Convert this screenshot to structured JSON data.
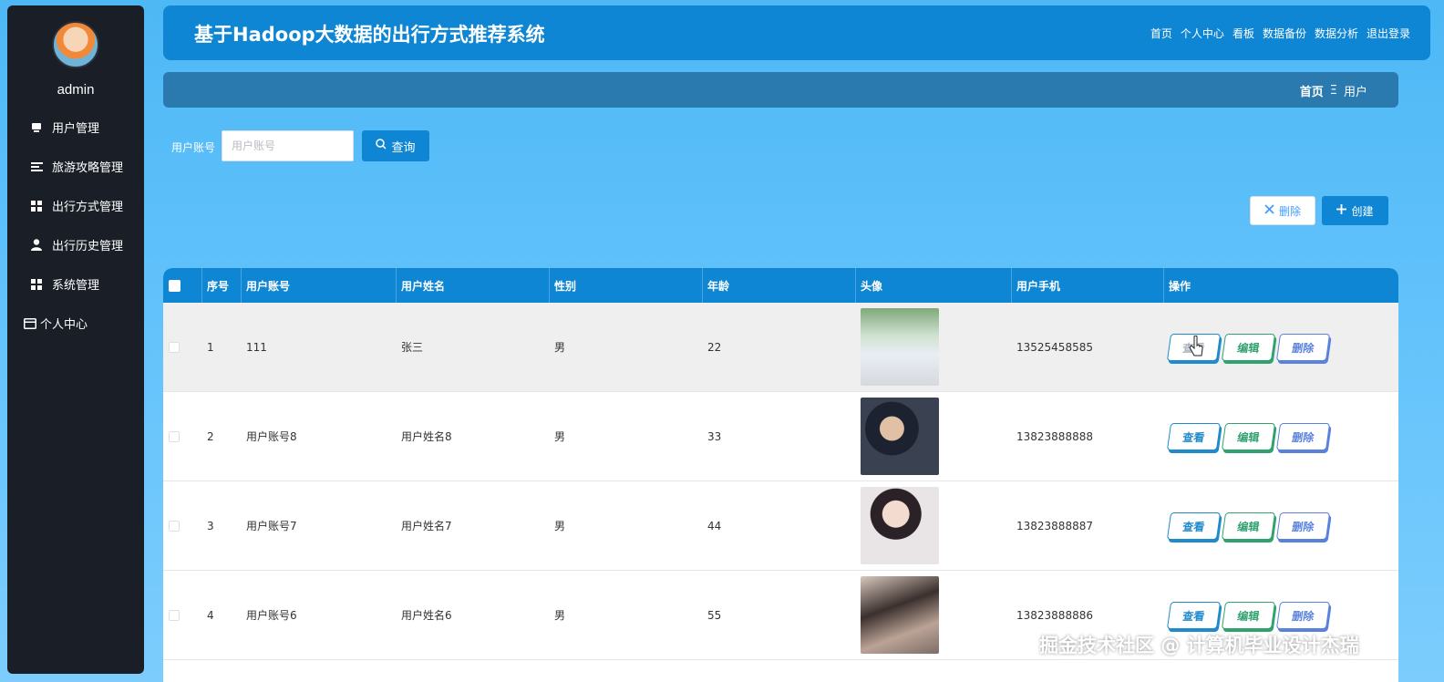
{
  "sidebar": {
    "username": "admin",
    "items": [
      {
        "label": "用户管理",
        "icon": "user-management-icon"
      },
      {
        "label": "旅游攻略管理",
        "icon": "list-icon"
      },
      {
        "label": "出行方式管理",
        "icon": "grid-icon"
      },
      {
        "label": "出行历史管理",
        "icon": "person-icon"
      },
      {
        "label": "系统管理",
        "icon": "grid-icon"
      },
      {
        "label": "个人中心",
        "icon": "wallet-icon"
      }
    ]
  },
  "header": {
    "title": "基于Hadoop大数据的出行方式推荐系统",
    "nav": [
      "首页",
      "个人中心",
      "看板",
      "数据备份",
      "数据分析",
      "退出登录"
    ]
  },
  "breadcrumb": {
    "home": "首页",
    "separator": "Ξ",
    "current": "用户"
  },
  "search": {
    "label": "用户账号",
    "placeholder": "用户账号",
    "value": "",
    "button": "查询"
  },
  "actions": {
    "delete": "删除",
    "create": "创建"
  },
  "table": {
    "columns": [
      "序号",
      "用户账号",
      "用户姓名",
      "性别",
      "年龄",
      "头像",
      "用户手机",
      "操作"
    ],
    "rows": [
      {
        "index": "1",
        "account": "111",
        "name": "张三",
        "gender": "男",
        "age": "22",
        "phone": "13525458585"
      },
      {
        "index": "2",
        "account": "用户账号8",
        "name": "用户姓名8",
        "gender": "男",
        "age": "33",
        "phone": "13823888888"
      },
      {
        "index": "3",
        "account": "用户账号7",
        "name": "用户姓名7",
        "gender": "男",
        "age": "44",
        "phone": "13823888887"
      },
      {
        "index": "4",
        "account": "用户账号6",
        "name": "用户姓名6",
        "gender": "男",
        "age": "55",
        "phone": "13823888886"
      }
    ],
    "row_actions": {
      "view": "查看",
      "edit": "编辑",
      "delete": "删除"
    }
  },
  "watermark": "掘金技术社区 @ 计算机毕业设计杰瑞",
  "colors": {
    "primary": "#0f86d3",
    "sidebar": "#1a1f27",
    "crumb_bar": "#2a7ab0",
    "edit": "#31a26f",
    "delete": "#5a82dc"
  }
}
